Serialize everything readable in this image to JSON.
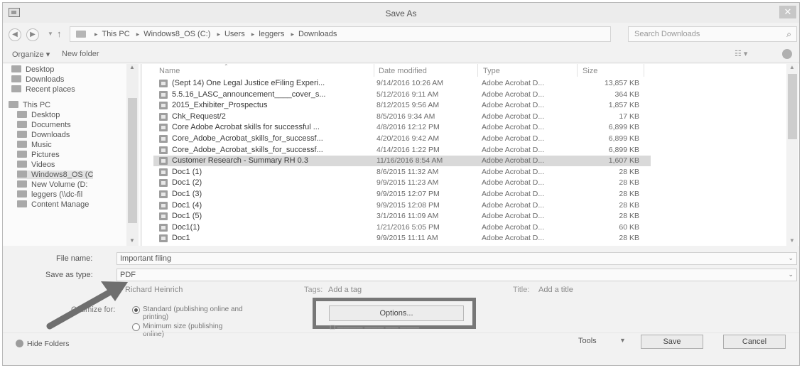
{
  "window": {
    "title": "Save As",
    "close_label": "✕"
  },
  "address": {
    "crumbs": [
      "This PC",
      "Windows8_OS (C:)",
      "Users",
      "leggers",
      "Downloads"
    ],
    "search_placeholder": "Search Downloads"
  },
  "commands": {
    "organize": "Organize ▾",
    "new_folder": "New folder"
  },
  "nav": {
    "items": [
      "Desktop",
      "Downloads",
      "Recent places",
      "This PC",
      "Desktop",
      "Documents",
      "Downloads",
      "Music",
      "Pictures",
      "Videos",
      "Windows8_OS (C",
      "New Volume (D:",
      "leggers (\\\\dc-fil",
      "Content Manage"
    ]
  },
  "columns": {
    "name": "Name",
    "date": "Date modified",
    "type": "Type",
    "size": "Size"
  },
  "files": [
    {
      "name": "(Sept 14) One Legal Justice eFiling Experi...",
      "date": "9/14/2016 10:26 AM",
      "type": "Adobe Acrobat D...",
      "size": "13,857 KB"
    },
    {
      "name": "5.5.16_LASC_announcement____cover_s...",
      "date": "5/12/2016 9:11 AM",
      "type": "Adobe Acrobat D...",
      "size": "364 KB"
    },
    {
      "name": "2015_Exhibiter_Prospectus",
      "date": "8/12/2015 9:56 AM",
      "type": "Adobe Acrobat D...",
      "size": "1,857 KB"
    },
    {
      "name": "Chk_Request/2",
      "date": "8/5/2016 9:34 AM",
      "type": "Adobe Acrobat D...",
      "size": "17 KB"
    },
    {
      "name": "Core Adobe Acrobat skills for successful ...",
      "date": "4/8/2016 12:12 PM",
      "type": "Adobe Acrobat D...",
      "size": "6,899 KB"
    },
    {
      "name": "Core_Adobe_Acrobat_skills_for_successf...",
      "date": "4/20/2016 9:42 AM",
      "type": "Adobe Acrobat D...",
      "size": "6,899 KB"
    },
    {
      "name": "Core_Adobe_Acrobat_skills_for_successf...",
      "date": "4/14/2016 1:22 PM",
      "type": "Adobe Acrobat D...",
      "size": "6,899 KB"
    },
    {
      "name": "Customer Research - Summary  RH 0.3",
      "date": "11/16/2016 8:54 AM",
      "type": "Adobe Acrobat D...",
      "size": "1,607 KB"
    },
    {
      "name": "Doc1 (1)",
      "date": "8/6/2015 11:32 AM",
      "type": "Adobe Acrobat D...",
      "size": "28 KB"
    },
    {
      "name": "Doc1 (2)",
      "date": "9/9/2015 11:23 AM",
      "type": "Adobe Acrobat D...",
      "size": "28 KB"
    },
    {
      "name": "Doc1 (3)",
      "date": "9/9/2015 12:07 PM",
      "type": "Adobe Acrobat D...",
      "size": "28 KB"
    },
    {
      "name": "Doc1 (4)",
      "date": "9/9/2015 12:08 PM",
      "type": "Adobe Acrobat D...",
      "size": "28 KB"
    },
    {
      "name": "Doc1 (5)",
      "date": "3/1/2016 11:09 AM",
      "type": "Adobe Acrobat D...",
      "size": "28 KB"
    },
    {
      "name": "Doc1(1)",
      "date": "1/21/2016 5:05 PM",
      "type": "Adobe Acrobat D...",
      "size": "60 KB"
    },
    {
      "name": "Doc1",
      "date": "9/9/2015 11:11 AM",
      "type": "Adobe Acrobat D...",
      "size": "28 KB"
    }
  ],
  "selected_file": "Customer Research - Summary  RH 0.3",
  "save": {
    "file_name_label": "File name:",
    "file_name_value": "Important filing",
    "save_type_label": "Save as type:",
    "save_type_value": "PDF",
    "authors_value": "Richard Heinrich",
    "tags_label": "Tags:",
    "tags_value": "Add a tag",
    "title_label": "Title:",
    "title_value": "Add a title",
    "optimize_label": "Optimize for:",
    "opt_standard": "Standard (publishing online and printing)",
    "opt_minimum": "Minimum size (publishing online)",
    "options_button": "Options..."
  },
  "footer": {
    "hide_folders": "Hide Folders",
    "tools": "Tools",
    "save_button": "Save",
    "cancel_button": "Cancel"
  },
  "colors": {
    "annotation_arrow": "#6f6f6f",
    "highlight_box": "#777777",
    "selected_row": "#d9d9d9"
  },
  "icons": [
    "app-icon",
    "back-icon",
    "forward-icon",
    "up-icon",
    "folder-icon",
    "refresh-icon",
    "search-icon",
    "view-icon",
    "help-icon",
    "pdf-file-icon",
    "hide-folders-icon"
  ]
}
